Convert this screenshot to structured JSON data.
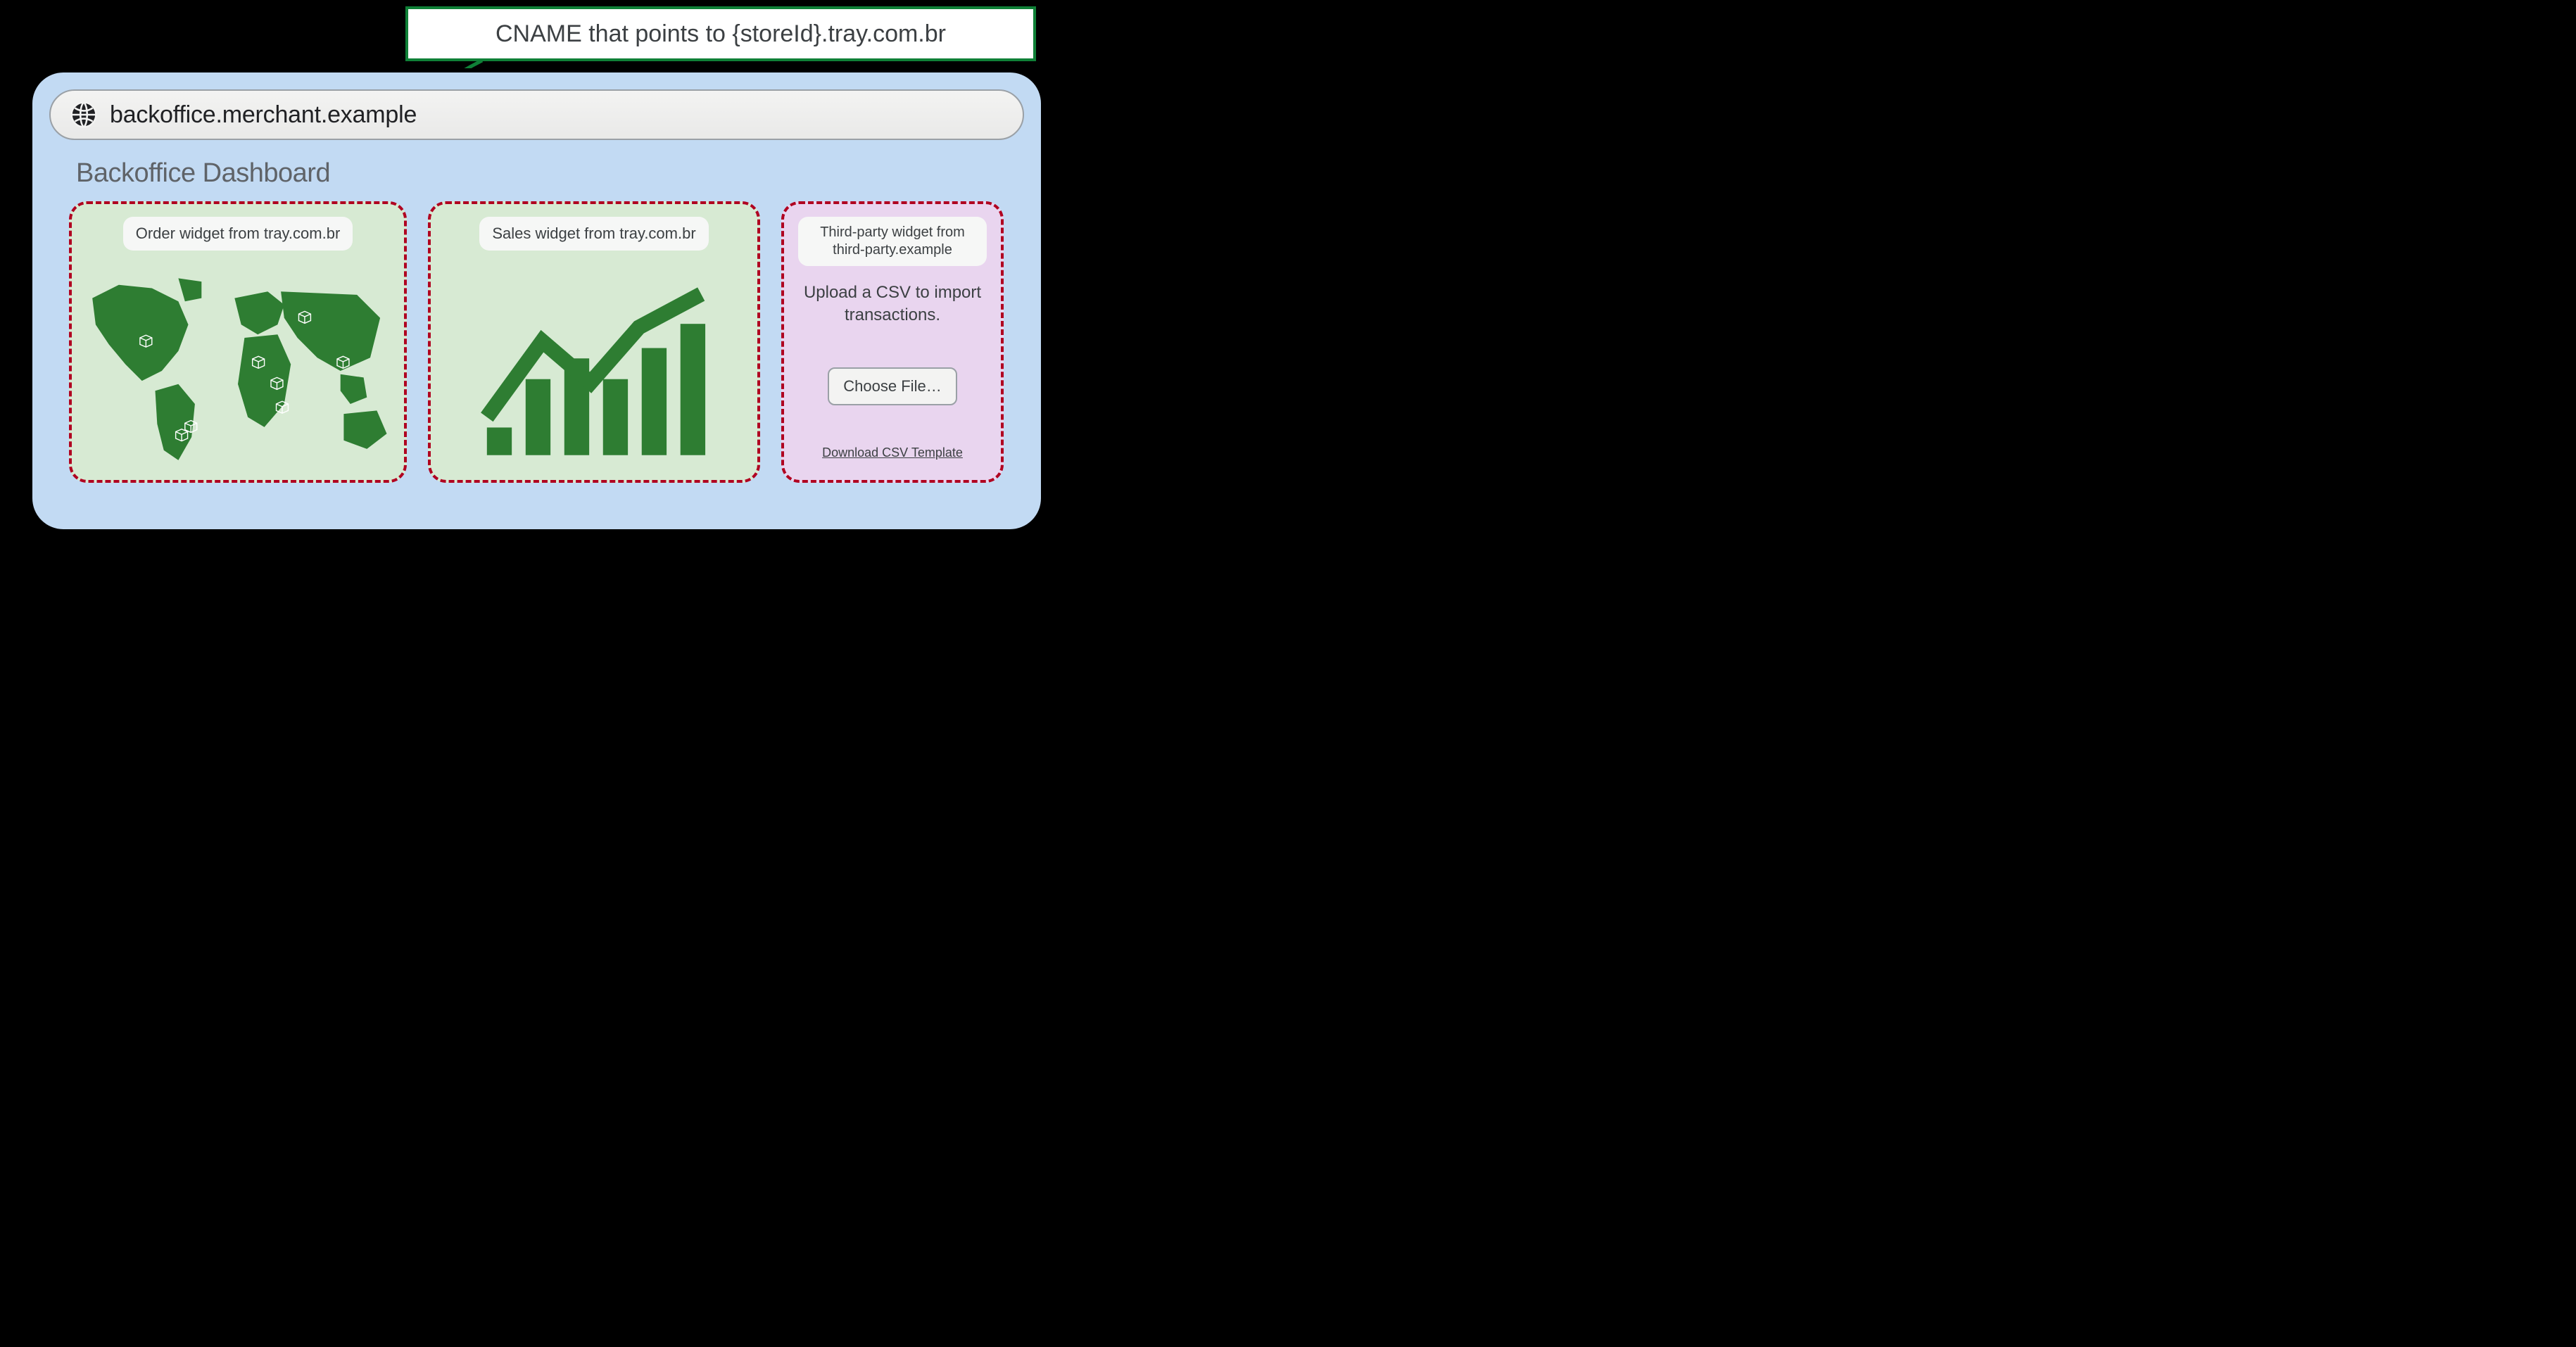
{
  "callout": {
    "text": "CNAME that points to {storeId}.tray.com.br"
  },
  "browser": {
    "url": "backoffice.merchant.example"
  },
  "page": {
    "title": "Backoffice Dashboard"
  },
  "widgets": {
    "order": {
      "label": "Order widget from tray.com.br"
    },
    "sales": {
      "label": "Sales widget from tray.com.br"
    },
    "third_party": {
      "label": "Third-party widget from third-party.example",
      "upload_message": "Upload a CSV to import transactions.",
      "choose_button": "Choose File…",
      "download_link": "Download CSV Template"
    }
  },
  "colors": {
    "callout_border": "#0f8037",
    "widget_dash": "#b00020",
    "green_widget_bg": "#d7ead3",
    "purple_widget_bg": "#e9d5ef",
    "browser_bg": "#c2daf3",
    "accent_green": "#2e7d32"
  }
}
